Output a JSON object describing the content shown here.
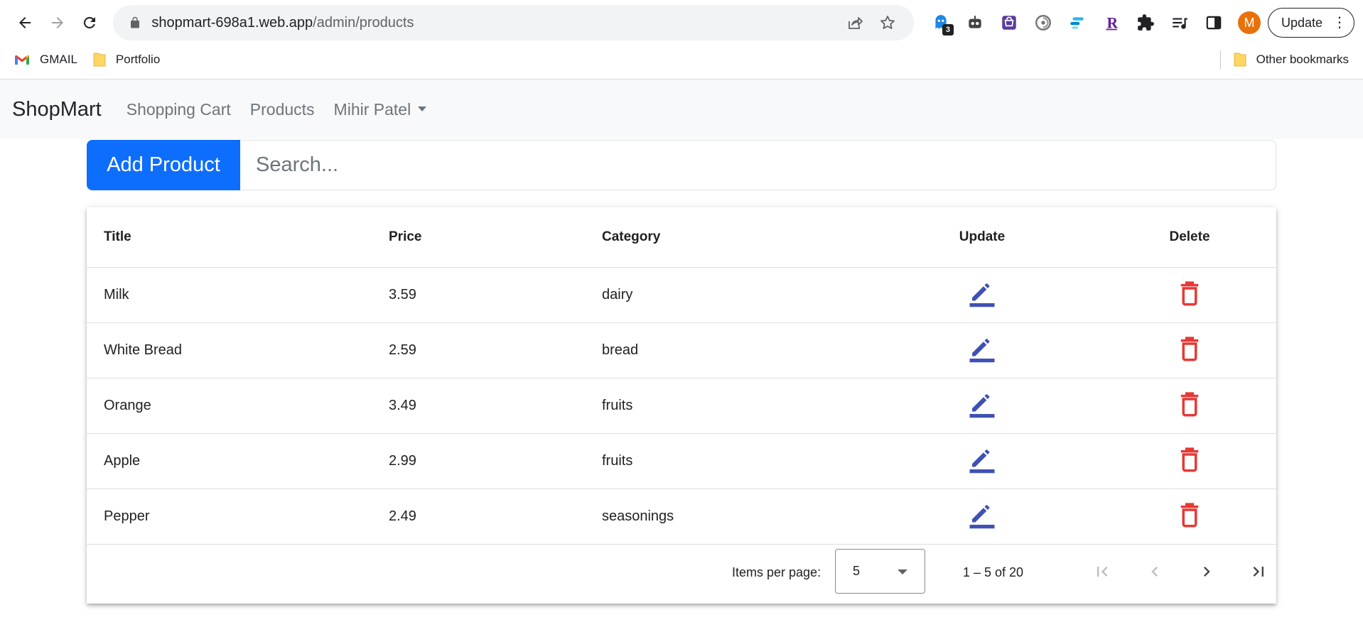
{
  "browser": {
    "url_host": "shopmart-698a1.web.app",
    "url_path": "/admin/products",
    "ext_badge": "3",
    "avatar_letter": "M",
    "update_label": "Update",
    "bookmarks": [
      "GMAIL",
      "Portfolio"
    ],
    "other_bookmarks": "Other bookmarks"
  },
  "navbar": {
    "brand": "ShopMart",
    "links": [
      "Shopping Cart",
      "Products"
    ],
    "user": "Mihir Patel"
  },
  "toolbar": {
    "add_label": "Add Product",
    "search_placeholder": "Search..."
  },
  "table": {
    "columns": [
      "Title",
      "Price",
      "Category",
      "Update",
      "Delete"
    ],
    "rows": [
      {
        "title": "Milk",
        "price": "3.59",
        "category": "dairy"
      },
      {
        "title": "White Bread",
        "price": "2.59",
        "category": "bread"
      },
      {
        "title": "Orange",
        "price": "3.49",
        "category": "fruits"
      },
      {
        "title": "Apple",
        "price": "2.99",
        "category": "fruits"
      },
      {
        "title": "Pepper",
        "price": "2.49",
        "category": "seasonings"
      }
    ]
  },
  "paginator": {
    "items_label": "Items per page:",
    "page_size": "5",
    "range_label": "1 – 5 of 20"
  },
  "colors": {
    "primary": "#0d6efd",
    "edit_icon": "#3f51b5",
    "delete_icon": "#e53935"
  }
}
